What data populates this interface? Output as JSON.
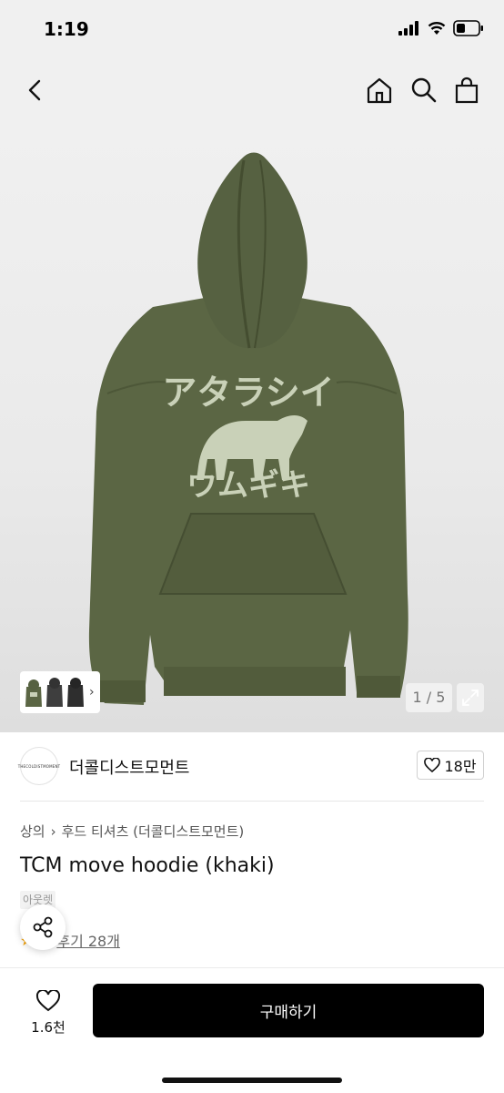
{
  "status_bar": {
    "time": "1:19"
  },
  "nav": {
    "back_icon": "chevron-left-icon",
    "home_icon": "home-icon",
    "search_icon": "search-icon",
    "bag_icon": "shopping-bag-icon"
  },
  "gallery": {
    "page_counter": "1 / 5",
    "hoodie_print_top": "アタラシイ",
    "hoodie_print_bottom": "ウムギキ",
    "hoodie_color": "#5b6644",
    "print_color": "#c9d1b8"
  },
  "seller": {
    "logo_text": "THECOLDISTMOMENT",
    "name": "더콜디스트모먼트",
    "likes": "18만"
  },
  "product": {
    "breadcrumb": [
      "상의",
      "후드 티셔츠 (더콜디스트모먼트)"
    ],
    "title": "TCM move hoodie (khaki)",
    "partner_badge": "아웃렛",
    "review_link": "후기 28개"
  },
  "bottom_bar": {
    "wish_count": "1.6천",
    "buy_label": "구매하기"
  }
}
